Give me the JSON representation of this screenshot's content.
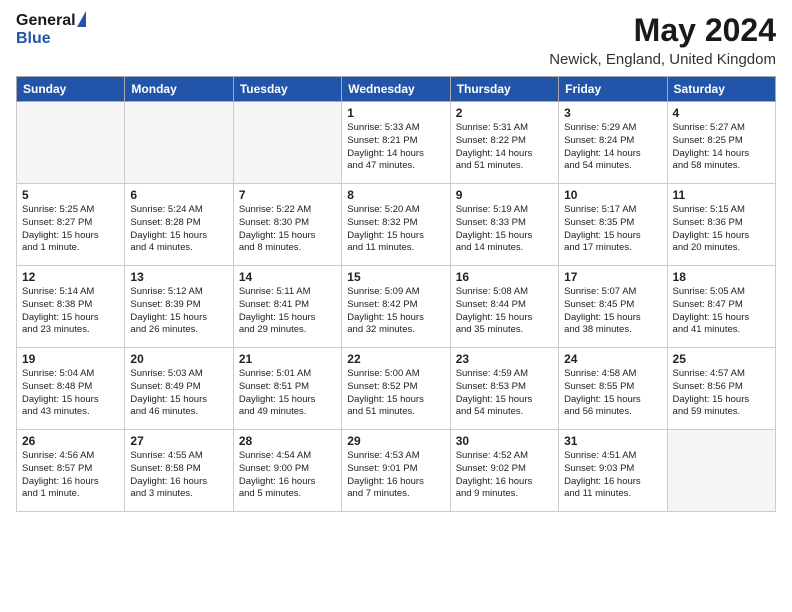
{
  "header": {
    "logo_general": "General",
    "logo_blue": "Blue",
    "month_title": "May 2024",
    "location": "Newick, England, United Kingdom"
  },
  "days_of_week": [
    "Sunday",
    "Monday",
    "Tuesday",
    "Wednesday",
    "Thursday",
    "Friday",
    "Saturday"
  ],
  "weeks": [
    [
      {
        "day": "",
        "text": ""
      },
      {
        "day": "",
        "text": ""
      },
      {
        "day": "",
        "text": ""
      },
      {
        "day": "1",
        "text": "Sunrise: 5:33 AM\nSunset: 8:21 PM\nDaylight: 14 hours\nand 47 minutes."
      },
      {
        "day": "2",
        "text": "Sunrise: 5:31 AM\nSunset: 8:22 PM\nDaylight: 14 hours\nand 51 minutes."
      },
      {
        "day": "3",
        "text": "Sunrise: 5:29 AM\nSunset: 8:24 PM\nDaylight: 14 hours\nand 54 minutes."
      },
      {
        "day": "4",
        "text": "Sunrise: 5:27 AM\nSunset: 8:25 PM\nDaylight: 14 hours\nand 58 minutes."
      }
    ],
    [
      {
        "day": "5",
        "text": "Sunrise: 5:25 AM\nSunset: 8:27 PM\nDaylight: 15 hours\nand 1 minute."
      },
      {
        "day": "6",
        "text": "Sunrise: 5:24 AM\nSunset: 8:28 PM\nDaylight: 15 hours\nand 4 minutes."
      },
      {
        "day": "7",
        "text": "Sunrise: 5:22 AM\nSunset: 8:30 PM\nDaylight: 15 hours\nand 8 minutes."
      },
      {
        "day": "8",
        "text": "Sunrise: 5:20 AM\nSunset: 8:32 PM\nDaylight: 15 hours\nand 11 minutes."
      },
      {
        "day": "9",
        "text": "Sunrise: 5:19 AM\nSunset: 8:33 PM\nDaylight: 15 hours\nand 14 minutes."
      },
      {
        "day": "10",
        "text": "Sunrise: 5:17 AM\nSunset: 8:35 PM\nDaylight: 15 hours\nand 17 minutes."
      },
      {
        "day": "11",
        "text": "Sunrise: 5:15 AM\nSunset: 8:36 PM\nDaylight: 15 hours\nand 20 minutes."
      }
    ],
    [
      {
        "day": "12",
        "text": "Sunrise: 5:14 AM\nSunset: 8:38 PM\nDaylight: 15 hours\nand 23 minutes."
      },
      {
        "day": "13",
        "text": "Sunrise: 5:12 AM\nSunset: 8:39 PM\nDaylight: 15 hours\nand 26 minutes."
      },
      {
        "day": "14",
        "text": "Sunrise: 5:11 AM\nSunset: 8:41 PM\nDaylight: 15 hours\nand 29 minutes."
      },
      {
        "day": "15",
        "text": "Sunrise: 5:09 AM\nSunset: 8:42 PM\nDaylight: 15 hours\nand 32 minutes."
      },
      {
        "day": "16",
        "text": "Sunrise: 5:08 AM\nSunset: 8:44 PM\nDaylight: 15 hours\nand 35 minutes."
      },
      {
        "day": "17",
        "text": "Sunrise: 5:07 AM\nSunset: 8:45 PM\nDaylight: 15 hours\nand 38 minutes."
      },
      {
        "day": "18",
        "text": "Sunrise: 5:05 AM\nSunset: 8:47 PM\nDaylight: 15 hours\nand 41 minutes."
      }
    ],
    [
      {
        "day": "19",
        "text": "Sunrise: 5:04 AM\nSunset: 8:48 PM\nDaylight: 15 hours\nand 43 minutes."
      },
      {
        "day": "20",
        "text": "Sunrise: 5:03 AM\nSunset: 8:49 PM\nDaylight: 15 hours\nand 46 minutes."
      },
      {
        "day": "21",
        "text": "Sunrise: 5:01 AM\nSunset: 8:51 PM\nDaylight: 15 hours\nand 49 minutes."
      },
      {
        "day": "22",
        "text": "Sunrise: 5:00 AM\nSunset: 8:52 PM\nDaylight: 15 hours\nand 51 minutes."
      },
      {
        "day": "23",
        "text": "Sunrise: 4:59 AM\nSunset: 8:53 PM\nDaylight: 15 hours\nand 54 minutes."
      },
      {
        "day": "24",
        "text": "Sunrise: 4:58 AM\nSunset: 8:55 PM\nDaylight: 15 hours\nand 56 minutes."
      },
      {
        "day": "25",
        "text": "Sunrise: 4:57 AM\nSunset: 8:56 PM\nDaylight: 15 hours\nand 59 minutes."
      }
    ],
    [
      {
        "day": "26",
        "text": "Sunrise: 4:56 AM\nSunset: 8:57 PM\nDaylight: 16 hours\nand 1 minute."
      },
      {
        "day": "27",
        "text": "Sunrise: 4:55 AM\nSunset: 8:58 PM\nDaylight: 16 hours\nand 3 minutes."
      },
      {
        "day": "28",
        "text": "Sunrise: 4:54 AM\nSunset: 9:00 PM\nDaylight: 16 hours\nand 5 minutes."
      },
      {
        "day": "29",
        "text": "Sunrise: 4:53 AM\nSunset: 9:01 PM\nDaylight: 16 hours\nand 7 minutes."
      },
      {
        "day": "30",
        "text": "Sunrise: 4:52 AM\nSunset: 9:02 PM\nDaylight: 16 hours\nand 9 minutes."
      },
      {
        "day": "31",
        "text": "Sunrise: 4:51 AM\nSunset: 9:03 PM\nDaylight: 16 hours\nand 11 minutes."
      },
      {
        "day": "",
        "text": ""
      }
    ]
  ]
}
